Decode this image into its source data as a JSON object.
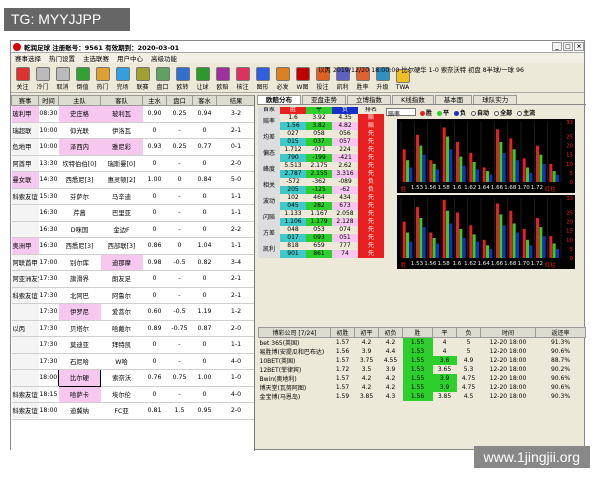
{
  "watermark": "TG: MYYJJPP",
  "site": "www.1jingjii.org",
  "title": "乾润足球 注册账号：9561 有效期到：2020-03-01",
  "win_buttons": [
    "_",
    "□",
    "×"
  ],
  "menu": [
    "赛事选择",
    "热门设置",
    "主选联赛",
    "用户中心",
    "高级功能"
  ],
  "toolbar": [
    {
      "l": "关注",
      "c": "#e03030"
    },
    {
      "l": "冷门",
      "c": "#bbb"
    },
    {
      "l": "取消",
      "c": "#bbb"
    },
    {
      "l": "倒值",
      "c": "#30a030"
    },
    {
      "l": "热门",
      "c": "#e0a030"
    },
    {
      "l": "完场",
      "c": "#30a0e0"
    },
    {
      "l": "联赛",
      "c": "#a0a030"
    },
    {
      "l": "盘口",
      "c": "#60a060"
    },
    {
      "l": "欧转",
      "c": "#3070d0"
    },
    {
      "l": "让球",
      "c": "#2a9a2a"
    },
    {
      "l": "欧赔",
      "c": "#a030a0"
    },
    {
      "l": "核注",
      "c": "#e03060"
    },
    {
      "l": "图形",
      "c": "#3060e0"
    },
    {
      "l": "必发",
      "c": "#dd8020"
    },
    {
      "l": "W图",
      "c": "#c00000"
    },
    {
      "l": "投注",
      "c": "#e06020"
    },
    {
      "l": "凯利",
      "c": "#6060c0"
    },
    {
      "l": "胜率",
      "c": "#e06030"
    },
    {
      "l": "升级",
      "c": "#3090c0"
    },
    {
      "l": "TWA",
      "c": "#f0c020"
    }
  ],
  "match_info": "以丙  2019/12/20  18:00:00  比尔硬华 1-0 索奈沃特  初盘 8半球/一球 96",
  "left_headers": [
    "赛事",
    "时间",
    "主队",
    "客队",
    "主水",
    "盘口",
    "客水",
    "结果"
  ],
  "rows": [
    [
      "玻利甲",
      "08:30",
      "史庄格",
      "玻利瓦",
      "0.90",
      "0.25",
      "0.94",
      "3-2"
    ],
    [
      "瑞超联",
      "10:00",
      "仰光联",
      "伊洛瓦",
      "0",
      "-",
      "0",
      "2-1"
    ],
    [
      "危地甲",
      "10:00",
      "泽西内",
      "雅尼彩",
      "0.93",
      "0.25",
      "0.77",
      "0-1"
    ],
    [
      "阿酋甲",
      "13:30",
      "坎特伯伯[0]",
      "瑞斯曼[0]",
      "0",
      "-",
      "0",
      "2-0"
    ],
    [
      "曼女联",
      "14:30",
      "西悉尼[3]",
      "惠灵顿[2]",
      "1.00",
      "0",
      "0.84",
      "5-0"
    ],
    [
      "",
      "15:30",
      "芬萨尔",
      "马辛迪",
      "0",
      "-",
      "0",
      "1-1"
    ],
    [
      "",
      "16:30",
      "芹菖",
      "巴里亚",
      "0",
      "-",
      "0",
      "1-1"
    ],
    [
      "",
      "16:30",
      "D咪国",
      "金边F",
      "0",
      "-",
      "0",
      "2-2"
    ],
    [
      "奥洲甲",
      "16:30",
      "西悉尼[3]",
      "西部联[3]",
      "0.86",
      "0",
      "1.04",
      "1-1"
    ],
    [
      "阿联酋甲",
      "17:00",
      "别尔库",
      "迪那摩",
      "0.98",
      "-0.5",
      "0.82",
      "3-4"
    ],
    [
      "",
      "17:30",
      "旗滑界",
      "朗友足",
      "0",
      "-",
      "0",
      "2-1"
    ],
    [
      "",
      "17:30",
      "北阿巴",
      "阿鲁尔",
      "0",
      "-",
      "0",
      "2-1"
    ],
    [
      "",
      "17:30",
      "伊罗尼",
      "爱菩尔",
      "0.60",
      "-0.5",
      "1.19",
      "1-2"
    ],
    [
      "",
      "17:30",
      "贝塔尔",
      "哈戴尔",
      "0.89",
      "-0.75",
      "0.87",
      "2-0"
    ],
    [
      "",
      "17:30",
      "莫迪亚",
      "拜特凯",
      "0",
      "-",
      "0",
      "1-1"
    ],
    [
      "",
      "17:30",
      "石尼哈",
      "W哈",
      "0",
      "-",
      "0",
      "4-0"
    ],
    [
      "",
      "18:00",
      "比尔硬",
      "索奈沃",
      "0.76",
      "0.75",
      "1.00",
      "1-0"
    ],
    [
      "",
      "18:15",
      "哈萨卡",
      "埃尔伦",
      "0",
      "-",
      "0",
      "4-0"
    ],
    [
      "",
      "18:00",
      "迪冀纳",
      "FC亚",
      "0.81",
      "1.5",
      "0.95",
      "2-0"
    ]
  ],
  "left_col": [
    "",
    "",
    "",
    "",
    "",
    "科索友谊",
    "",
    "",
    "",
    "",
    "阿亚洲友谊",
    "科索友谊",
    "",
    "以丙",
    "",
    "",
    "",
    "科索友谊",
    "科索友谊"
  ],
  "tabs": [
    "欧赔分布",
    "亚盘走势",
    "立博指数",
    "K线指数",
    "基本面",
    "球队实力"
  ],
  "stats_head": [
    "首家",
    "胜",
    "平",
    "负",
    "排名"
  ],
  "stats": [
    {
      "label": "赔率",
      "rows": [
        [
          "1.6",
          "3.92",
          "4.35",
          "赔"
        ],
        [
          "1.56",
          "3.82",
          "4.82",
          "赔"
        ]
      ]
    },
    {
      "label": "均差",
      "rows": [
        [
          "027",
          "058",
          "056",
          "先"
        ],
        [
          "015",
          "037",
          "057",
          "先"
        ]
      ]
    },
    {
      "label": "偏态",
      "rows": [
        [
          "1.712",
          "-071",
          "224",
          "先"
        ],
        [
          "790",
          "-199",
          "-421",
          "先"
        ]
      ]
    },
    {
      "label": "峰度",
      "rows": [
        [
          "5.513",
          "2.175",
          "2.62",
          "先"
        ],
        [
          "2.787",
          "2.155",
          "3.316",
          "先"
        ]
      ]
    },
    {
      "label": "相关",
      "rows": [
        [
          "-572",
          "-362",
          "-089",
          "负"
        ],
        [
          "205",
          "-125",
          "-62",
          "负"
        ]
      ]
    },
    {
      "label": "波动",
      "rows": [
        [
          "102",
          "464",
          "434",
          "先"
        ],
        [
          "045",
          "282",
          "673",
          "先"
        ]
      ]
    },
    {
      "label": "闪赔",
      "rows": [
        [
          "1.133",
          "1.167",
          "2.058",
          "先"
        ],
        [
          "1.106",
          "1.179",
          "2.128",
          "先"
        ]
      ]
    },
    {
      "label": "方差",
      "rows": [
        [
          "048",
          "053",
          "074",
          "先"
        ],
        [
          "017",
          "093",
          "051",
          "先"
        ]
      ]
    },
    {
      "label": "凯利",
      "rows": [
        [
          "818",
          "659",
          "777",
          "先"
        ],
        [
          "901",
          "861",
          "74",
          "先"
        ]
      ]
    }
  ],
  "controls": {
    "select": "赔率",
    "r1": "胜",
    "r2": "平",
    "r3": "负",
    "r4": "全部",
    "r5": "主流",
    "r6": "自动"
  },
  "chart_data": [
    {
      "type": "bar",
      "series": [
        {
          "name": "胜",
          "values": [
            18,
            26,
            12,
            30,
            22,
            16,
            8,
            29,
            24,
            13,
            20,
            10
          ]
        },
        {
          "name": "平",
          "values": [
            12,
            20,
            10,
            25,
            14,
            11,
            6,
            22,
            18,
            8,
            15,
            6
          ]
        },
        {
          "name": "负",
          "values": [
            8,
            15,
            7,
            18,
            9,
            7,
            4,
            16,
            12,
            5,
            10,
            4
          ]
        }
      ],
      "categories": [
        "胜",
        "1.53",
        "1.56",
        "1.58",
        "1.6",
        "1.62",
        "1.64",
        "1.66",
        "1.68",
        "1.70",
        "1.72",
        "红柱"
      ],
      "ylim": [
        0,
        33
      ],
      "yticks": [
        33,
        25,
        20,
        15,
        10,
        5,
        0
      ]
    },
    {
      "type": "bar",
      "series": [
        {
          "name": "胜",
          "values": [
            20,
            28,
            14,
            32,
            25,
            18,
            10,
            30,
            26,
            16,
            22,
            12
          ]
        },
        {
          "name": "平",
          "values": [
            14,
            22,
            11,
            26,
            16,
            13,
            7,
            24,
            19,
            10,
            17,
            8
          ]
        },
        {
          "name": "负",
          "values": [
            9,
            17,
            8,
            19,
            11,
            9,
            5,
            18,
            14,
            7,
            12,
            5
          ]
        }
      ],
      "categories": [
        "胜",
        "1.53",
        "1.56",
        "1.58",
        "1.6",
        "1.62",
        "1.64",
        "1.66",
        "1.68",
        "1.70",
        "1.72",
        "红柱"
      ],
      "ylim": [
        0,
        33
      ],
      "yticks": [
        33,
        25,
        20,
        15,
        10,
        5,
        0
      ]
    }
  ],
  "comp_head": [
    "博彩公司 [7/24]",
    "初胜",
    "初平",
    "初负",
    "胜",
    "平",
    "负",
    "时间",
    "返还率"
  ],
  "comp": [
    [
      "bet 365(英国)",
      "1.57",
      "4.2",
      "4.2",
      "1.55",
      "4",
      "5",
      "12-20 18:00",
      "91.3%"
    ],
    [
      "易胜博(安提瓜和巴布达)",
      "1.56",
      "3.9",
      "4.4",
      "1.53",
      "4",
      "5",
      "12-20 18:00",
      "90.6%"
    ],
    [
      "10BET(英国)",
      "1.57",
      "3.75",
      "4.55",
      "1.55",
      "3.6",
      "4.9",
      "12-20 18:00",
      "88.7%"
    ],
    [
      "12BET(菲律宾)",
      "1.72",
      "3.5",
      "3.9",
      "1.53",
      "3.65",
      "5.3",
      "12-20 18:00",
      "90.2%"
    ],
    [
      "Bwin(奥地利)",
      "1.57",
      "4.2",
      "4.2",
      "1.55",
      "3.9",
      "4.75",
      "12-20 18:00",
      "90.6%"
    ],
    [
      "博天堂(瓦努阿图)",
      "1.57",
      "4.2",
      "4.2",
      "1.55",
      "3.9",
      "4.75",
      "12-20 18:00",
      "90.6%"
    ],
    [
      "金宝博(马恩岛)",
      "1.59",
      "3.85",
      "4.3",
      "1.56",
      "3.85",
      "4.5",
      "12-20 18:00",
      "90.3%"
    ]
  ]
}
